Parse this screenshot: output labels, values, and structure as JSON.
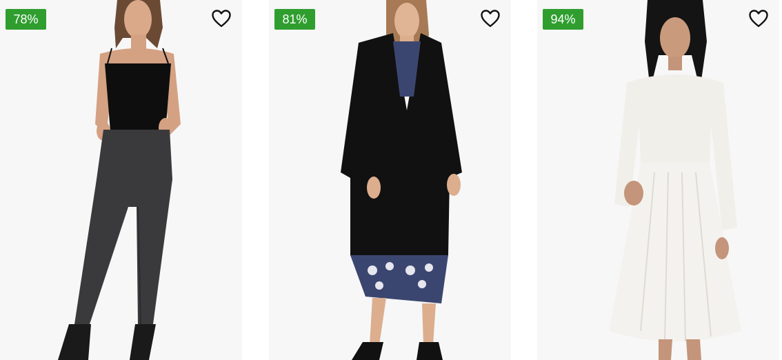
{
  "colors": {
    "badge_bg": "#2f9e2f",
    "card_bg": "#f7f7f7",
    "heart_stroke": "#111111"
  },
  "products": [
    {
      "discount": "78%",
      "wishlist_icon": "heart-outline-icon",
      "image": "model-black-camisole-grey-skinny-jeans"
    },
    {
      "discount": "81%",
      "wishlist_icon": "heart-outline-icon",
      "image": "model-black-long-coat-printed-dress"
    },
    {
      "discount": "94%",
      "wishlist_icon": "heart-outline-icon",
      "image": "model-white-lace-pleated-dress"
    }
  ]
}
